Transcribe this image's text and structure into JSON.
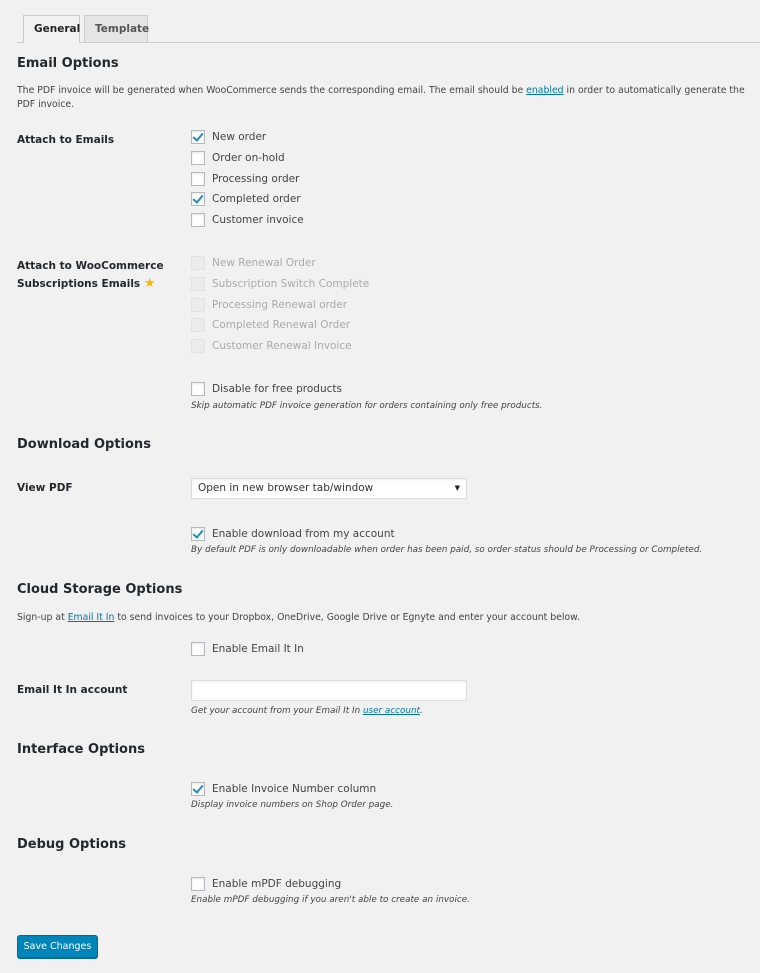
{
  "tabs": [
    {
      "label": "General",
      "active": true
    },
    {
      "label": "Template",
      "active": false
    }
  ],
  "email_options": {
    "heading": "Email Options",
    "intro_before": "The PDF invoice will be generated when WooCommerce sends the corresponding email. The email should be ",
    "intro_link": "enabled",
    "intro_after": " in order to automatically generate the PDF invoice.",
    "attach_label": "Attach to Emails",
    "attach_items": [
      {
        "label": "New order",
        "checked": true
      },
      {
        "label": "Order on-hold",
        "checked": false
      },
      {
        "label": "Processing order",
        "checked": false
      },
      {
        "label": "Completed order",
        "checked": true
      },
      {
        "label": "Customer invoice",
        "checked": false
      }
    ],
    "subs_label_line1": "Attach to WooCommerce",
    "subs_label_line2": "Subscriptions Emails",
    "subs_star": "★",
    "subs_items": [
      {
        "label": "New Renewal Order",
        "checked": false,
        "disabled": true
      },
      {
        "label": "Subscription Switch Complete",
        "checked": false,
        "disabled": true
      },
      {
        "label": "Processing Renewal order",
        "checked": false,
        "disabled": true
      },
      {
        "label": "Completed Renewal Order",
        "checked": false,
        "disabled": true
      },
      {
        "label": "Customer Renewal Invoice",
        "checked": false,
        "disabled": true
      }
    ],
    "free_products": {
      "label": "Disable for free products",
      "checked": false,
      "description": "Skip automatic PDF invoice generation for orders containing only free products."
    }
  },
  "download_options": {
    "heading": "Download Options",
    "view_pdf_label": "View PDF",
    "view_pdf_value": "Open in new browser tab/window",
    "dropdown_arrow": "▼",
    "my_account": {
      "label": "Enable download from my account",
      "checked": true,
      "description": "By default PDF is only downloadable when order has been paid, so order status should be Processing or Completed."
    }
  },
  "cloud_options": {
    "heading": "Cloud Storage Options",
    "intro_before": "Sign-up at ",
    "intro_link": "Email It In",
    "intro_after": " to send invoices to your Dropbox, OneDrive, Google Drive or Egnyte and enter your account below.",
    "enable": {
      "label": "Enable Email It In",
      "checked": false
    },
    "account_label": "Email It In account",
    "account_value": "",
    "account_desc_before": "Get your account from your Email It In ",
    "account_desc_link": "user account",
    "account_desc_after": "."
  },
  "interface_options": {
    "heading": "Interface Options",
    "invoice_column": {
      "label": "Enable Invoice Number column",
      "checked": true,
      "description": "Display invoice numbers on Shop Order page."
    }
  },
  "debug_options": {
    "heading": "Debug Options",
    "mpdf": {
      "label": "Enable mPDF debugging",
      "checked": false,
      "description": "Enable mPDF debugging if you aren't able to create an invoice."
    }
  },
  "save_button": "Save Changes"
}
